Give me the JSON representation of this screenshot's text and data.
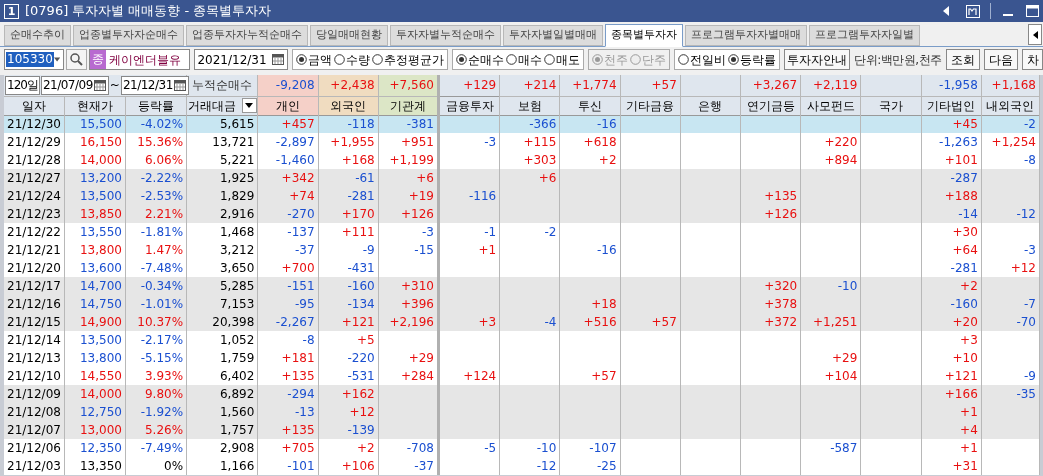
{
  "window": {
    "badge": "1",
    "title": "[0796] 투자자별 매매동향 - 종목별투자자"
  },
  "tabs": [
    {
      "label": "순매수추이",
      "selected": false
    },
    {
      "label": "업종별투자자순매수",
      "selected": false
    },
    {
      "label": "업종투자자누적순매수",
      "selected": false
    },
    {
      "label": "당일매매현황",
      "selected": false
    },
    {
      "label": "투자자별누적순매수",
      "selected": false
    },
    {
      "label": "투자자별일별매매",
      "selected": false
    },
    {
      "label": "종목별투자자",
      "selected": true
    },
    {
      "label": "프로그램투자자별매매",
      "selected": false
    },
    {
      "label": "프로그램투자자일별",
      "selected": false
    }
  ],
  "toolbar": {
    "code": "105330",
    "market_badge": "종",
    "stock_name": "케이엔더블유",
    "date": "2021/12/31",
    "radio_groups": [
      {
        "disabled": false,
        "options": [
          {
            "label": "금액",
            "selected": true
          },
          {
            "label": "수량",
            "selected": false
          },
          {
            "label": "추정평균가",
            "selected": false
          }
        ]
      },
      {
        "disabled": false,
        "options": [
          {
            "label": "순매수",
            "selected": true
          },
          {
            "label": "매수",
            "selected": false
          },
          {
            "label": "매도",
            "selected": false
          }
        ]
      },
      {
        "disabled": true,
        "options": [
          {
            "label": "천주",
            "selected": true
          },
          {
            "label": "단주",
            "selected": false
          }
        ]
      },
      {
        "disabled": false,
        "options": [
          {
            "label": "전일비",
            "selected": false
          },
          {
            "label": "등락률",
            "selected": true
          }
        ]
      }
    ],
    "guide_button": "투자자안내",
    "unit": "단위:백만원,천주",
    "buttons": [
      "조회",
      "다음",
      "차"
    ]
  },
  "summary": {
    "period": "120일",
    "from": "21/07/09",
    "tilde": "~",
    "to": "21/12/31",
    "label": "누적순매수",
    "values": [
      {
        "kind": "net",
        "text": "-9,208"
      },
      {
        "kind": "net",
        "text": "+2,438"
      },
      {
        "kind": "net",
        "text": "+7,560"
      },
      {
        "kind": "net",
        "text": "+129"
      },
      {
        "kind": "net",
        "text": "+214"
      },
      {
        "kind": "net",
        "text": "+1,774"
      },
      {
        "kind": "net",
        "text": "+57"
      },
      {
        "kind": "blank"
      },
      {
        "kind": "net",
        "text": "+3,267"
      },
      {
        "kind": "net",
        "text": "+2,119"
      },
      {
        "kind": "blank"
      },
      {
        "kind": "net",
        "text": "-1,958"
      },
      {
        "kind": "net",
        "text": "+1,168"
      }
    ]
  },
  "table": {
    "columns": [
      "일자",
      "현재가",
      "등락률",
      "거래대금",
      "개인",
      "외국인",
      "기관계",
      "금융투자",
      "보험",
      "투신",
      "기타금융",
      "은행",
      "연기금등",
      "사모펀드",
      "국가",
      "기타법인",
      "내외국인"
    ],
    "rows": [
      {
        "date": "21/12/30",
        "price": "15,500",
        "change": "-4.02%",
        "volume": "5,615",
        "color": "#1a4fd0",
        "shaded": false,
        "selected": true,
        "investors": [
          {
            "kind": "net",
            "text": "+457"
          },
          {
            "kind": "net",
            "text": "-118"
          },
          {
            "kind": "net",
            "text": "-381"
          },
          {
            "kind": "blank"
          },
          {
            "kind": "net",
            "text": "-366"
          },
          {
            "kind": "net",
            "text": "-16"
          },
          {
            "kind": "blank"
          },
          {
            "kind": "blank"
          },
          {
            "kind": "blank"
          },
          {
            "kind": "blank"
          },
          {
            "kind": "blank"
          },
          {
            "kind": "net",
            "text": "+45"
          },
          {
            "kind": "net",
            "text": "-2"
          }
        ]
      },
      {
        "date": "21/12/29",
        "price": "16,150",
        "change": "15.36%",
        "volume": "13,721",
        "color": "#e81010",
        "shaded": false,
        "selected": false,
        "investors": [
          {
            "kind": "net",
            "text": "-2,897"
          },
          {
            "kind": "net",
            "text": "+1,955"
          },
          {
            "kind": "net",
            "text": "+951"
          },
          {
            "kind": "net",
            "text": "-3"
          },
          {
            "kind": "net",
            "text": "+115"
          },
          {
            "kind": "net",
            "text": "+618"
          },
          {
            "kind": "blank"
          },
          {
            "kind": "blank"
          },
          {
            "kind": "blank"
          },
          {
            "kind": "net",
            "text": "+220"
          },
          {
            "kind": "blank"
          },
          {
            "kind": "net",
            "text": "-1,263"
          },
          {
            "kind": "net",
            "text": "+1,254"
          }
        ]
      },
      {
        "date": "21/12/28",
        "price": "14,000",
        "change": "6.06%",
        "volume": "5,221",
        "color": "#e81010",
        "shaded": false,
        "selected": false,
        "investors": [
          {
            "kind": "net",
            "text": "-1,460"
          },
          {
            "kind": "net",
            "text": "+168"
          },
          {
            "kind": "net",
            "text": "+1,199"
          },
          {
            "kind": "blank"
          },
          {
            "kind": "net",
            "text": "+303"
          },
          {
            "kind": "net",
            "text": "+2"
          },
          {
            "kind": "blank"
          },
          {
            "kind": "blank"
          },
          {
            "kind": "blank"
          },
          {
            "kind": "net",
            "text": "+894"
          },
          {
            "kind": "blank"
          },
          {
            "kind": "net",
            "text": "+101"
          },
          {
            "kind": "net",
            "text": "-8"
          }
        ]
      },
      {
        "date": "21/12/27",
        "price": "13,200",
        "change": "-2.22%",
        "volume": "1,925",
        "color": "#1a4fd0",
        "shaded": true,
        "selected": false,
        "investors": [
          {
            "kind": "net",
            "text": "+342"
          },
          {
            "kind": "net",
            "text": "-61"
          },
          {
            "kind": "net",
            "text": "+6"
          },
          {
            "kind": "blank"
          },
          {
            "kind": "net",
            "text": "+6"
          },
          {
            "kind": "blank"
          },
          {
            "kind": "blank"
          },
          {
            "kind": "blank"
          },
          {
            "kind": "blank"
          },
          {
            "kind": "blank"
          },
          {
            "kind": "blank"
          },
          {
            "kind": "net",
            "text": "-287"
          },
          {
            "kind": "blank"
          }
        ]
      },
      {
        "date": "21/12/24",
        "price": "13,500",
        "change": "-2.53%",
        "volume": "1,829",
        "color": "#1a4fd0",
        "shaded": true,
        "selected": false,
        "investors": [
          {
            "kind": "net",
            "text": "+74"
          },
          {
            "kind": "net",
            "text": "-281"
          },
          {
            "kind": "net",
            "text": "+19"
          },
          {
            "kind": "net",
            "text": "-116"
          },
          {
            "kind": "blank"
          },
          {
            "kind": "blank"
          },
          {
            "kind": "blank"
          },
          {
            "kind": "blank"
          },
          {
            "kind": "net",
            "text": "+135"
          },
          {
            "kind": "blank"
          },
          {
            "kind": "blank"
          },
          {
            "kind": "net",
            "text": "+188"
          },
          {
            "kind": "blank"
          }
        ]
      },
      {
        "date": "21/12/23",
        "price": "13,850",
        "change": "2.21%",
        "volume": "2,916",
        "color": "#e81010",
        "shaded": true,
        "selected": false,
        "investors": [
          {
            "kind": "net",
            "text": "-270"
          },
          {
            "kind": "net",
            "text": "+170"
          },
          {
            "kind": "net",
            "text": "+126"
          },
          {
            "kind": "blank"
          },
          {
            "kind": "blank"
          },
          {
            "kind": "blank"
          },
          {
            "kind": "blank"
          },
          {
            "kind": "blank"
          },
          {
            "kind": "net",
            "text": "+126"
          },
          {
            "kind": "blank"
          },
          {
            "kind": "blank"
          },
          {
            "kind": "net",
            "text": "-14"
          },
          {
            "kind": "net",
            "text": "-12"
          }
        ]
      },
      {
        "date": "21/12/22",
        "price": "13,550",
        "change": "-1.81%",
        "volume": "1,468",
        "color": "#1a4fd0",
        "shaded": false,
        "selected": false,
        "investors": [
          {
            "kind": "net",
            "text": "-137"
          },
          {
            "kind": "net",
            "text": "+111"
          },
          {
            "kind": "net",
            "text": "-3"
          },
          {
            "kind": "net",
            "text": "-1"
          },
          {
            "kind": "net",
            "text": "-2"
          },
          {
            "kind": "blank"
          },
          {
            "kind": "blank"
          },
          {
            "kind": "blank"
          },
          {
            "kind": "blank"
          },
          {
            "kind": "blank"
          },
          {
            "kind": "blank"
          },
          {
            "kind": "net",
            "text": "+30"
          },
          {
            "kind": "blank"
          }
        ]
      },
      {
        "date": "21/12/21",
        "price": "13,800",
        "change": "1.47%",
        "volume": "3,212",
        "color": "#e81010",
        "shaded": false,
        "selected": false,
        "investors": [
          {
            "kind": "net",
            "text": "-37"
          },
          {
            "kind": "net",
            "text": "-9"
          },
          {
            "kind": "net",
            "text": "-15"
          },
          {
            "kind": "net",
            "text": "+1"
          },
          {
            "kind": "blank"
          },
          {
            "kind": "net",
            "text": "-16"
          },
          {
            "kind": "blank"
          },
          {
            "kind": "blank"
          },
          {
            "kind": "blank"
          },
          {
            "kind": "blank"
          },
          {
            "kind": "blank"
          },
          {
            "kind": "net",
            "text": "+64"
          },
          {
            "kind": "net",
            "text": "-3"
          }
        ]
      },
      {
        "date": "21/12/20",
        "price": "13,600",
        "change": "-7.48%",
        "volume": "3,650",
        "color": "#1a4fd0",
        "shaded": false,
        "selected": false,
        "investors": [
          {
            "kind": "net",
            "text": "+700"
          },
          {
            "kind": "net",
            "text": "-431"
          },
          {
            "kind": "blank"
          },
          {
            "kind": "blank"
          },
          {
            "kind": "blank"
          },
          {
            "kind": "blank"
          },
          {
            "kind": "blank"
          },
          {
            "kind": "blank"
          },
          {
            "kind": "blank"
          },
          {
            "kind": "blank"
          },
          {
            "kind": "blank"
          },
          {
            "kind": "net",
            "text": "-281"
          },
          {
            "kind": "net",
            "text": "+12"
          }
        ]
      },
      {
        "date": "21/12/17",
        "price": "14,700",
        "change": "-0.34%",
        "volume": "5,285",
        "color": "#1a4fd0",
        "shaded": true,
        "selected": false,
        "investors": [
          {
            "kind": "net",
            "text": "-151"
          },
          {
            "kind": "net",
            "text": "-160"
          },
          {
            "kind": "net",
            "text": "+310"
          },
          {
            "kind": "blank"
          },
          {
            "kind": "blank"
          },
          {
            "kind": "blank"
          },
          {
            "kind": "blank"
          },
          {
            "kind": "blank"
          },
          {
            "kind": "net",
            "text": "+320"
          },
          {
            "kind": "net",
            "text": "-10"
          },
          {
            "kind": "blank"
          },
          {
            "kind": "net",
            "text": "+2"
          },
          {
            "kind": "blank"
          }
        ]
      },
      {
        "date": "21/12/16",
        "price": "14,750",
        "change": "-1.01%",
        "volume": "7,153",
        "color": "#1a4fd0",
        "shaded": true,
        "selected": false,
        "investors": [
          {
            "kind": "net",
            "text": "-95"
          },
          {
            "kind": "net",
            "text": "-134"
          },
          {
            "kind": "net",
            "text": "+396"
          },
          {
            "kind": "blank"
          },
          {
            "kind": "blank"
          },
          {
            "kind": "net",
            "text": "+18"
          },
          {
            "kind": "blank"
          },
          {
            "kind": "blank"
          },
          {
            "kind": "net",
            "text": "+378"
          },
          {
            "kind": "blank"
          },
          {
            "kind": "blank"
          },
          {
            "kind": "net",
            "text": "-160"
          },
          {
            "kind": "net",
            "text": "-7"
          }
        ]
      },
      {
        "date": "21/12/15",
        "price": "14,900",
        "change": "10.37%",
        "volume": "20,398",
        "color": "#e81010",
        "shaded": true,
        "selected": false,
        "investors": [
          {
            "kind": "net",
            "text": "-2,267"
          },
          {
            "kind": "net",
            "text": "+121"
          },
          {
            "kind": "net",
            "text": "+2,196"
          },
          {
            "kind": "net",
            "text": "+3"
          },
          {
            "kind": "net",
            "text": "-4"
          },
          {
            "kind": "net",
            "text": "+516"
          },
          {
            "kind": "net",
            "text": "+57"
          },
          {
            "kind": "blank"
          },
          {
            "kind": "net",
            "text": "+372"
          },
          {
            "kind": "net",
            "text": "+1,251"
          },
          {
            "kind": "blank"
          },
          {
            "kind": "net",
            "text": "+20"
          },
          {
            "kind": "net",
            "text": "-70"
          }
        ]
      },
      {
        "date": "21/12/14",
        "price": "13,500",
        "change": "-2.17%",
        "volume": "1,052",
        "color": "#1a4fd0",
        "shaded": false,
        "selected": false,
        "investors": [
          {
            "kind": "net",
            "text": "-8"
          },
          {
            "kind": "net",
            "text": "+5"
          },
          {
            "kind": "blank"
          },
          {
            "kind": "blank"
          },
          {
            "kind": "blank"
          },
          {
            "kind": "blank"
          },
          {
            "kind": "blank"
          },
          {
            "kind": "blank"
          },
          {
            "kind": "blank"
          },
          {
            "kind": "blank"
          },
          {
            "kind": "blank"
          },
          {
            "kind": "net",
            "text": "+3"
          },
          {
            "kind": "blank"
          }
        ]
      },
      {
        "date": "21/12/13",
        "price": "13,800",
        "change": "-5.15%",
        "volume": "1,759",
        "color": "#1a4fd0",
        "shaded": false,
        "selected": false,
        "investors": [
          {
            "kind": "net",
            "text": "+181"
          },
          {
            "kind": "net",
            "text": "-220"
          },
          {
            "kind": "net",
            "text": "+29"
          },
          {
            "kind": "blank"
          },
          {
            "kind": "blank"
          },
          {
            "kind": "blank"
          },
          {
            "kind": "blank"
          },
          {
            "kind": "blank"
          },
          {
            "kind": "blank"
          },
          {
            "kind": "net",
            "text": "+29"
          },
          {
            "kind": "blank"
          },
          {
            "kind": "net",
            "text": "+10"
          },
          {
            "kind": "blank"
          }
        ]
      },
      {
        "date": "21/12/10",
        "price": "14,550",
        "change": "3.93%",
        "volume": "6,402",
        "color": "#e81010",
        "shaded": false,
        "selected": false,
        "investors": [
          {
            "kind": "net",
            "text": "+135"
          },
          {
            "kind": "net",
            "text": "-531"
          },
          {
            "kind": "net",
            "text": "+284"
          },
          {
            "kind": "net",
            "text": "+124"
          },
          {
            "kind": "blank"
          },
          {
            "kind": "net",
            "text": "+57"
          },
          {
            "kind": "blank"
          },
          {
            "kind": "blank"
          },
          {
            "kind": "blank"
          },
          {
            "kind": "net",
            "text": "+104"
          },
          {
            "kind": "blank"
          },
          {
            "kind": "net",
            "text": "+121"
          },
          {
            "kind": "net",
            "text": "-9"
          }
        ]
      },
      {
        "date": "21/12/09",
        "price": "14,000",
        "change": "9.80%",
        "volume": "6,892",
        "color": "#e81010",
        "shaded": true,
        "selected": false,
        "investors": [
          {
            "kind": "net",
            "text": "-294"
          },
          {
            "kind": "net",
            "text": "+162"
          },
          {
            "kind": "blank"
          },
          {
            "kind": "blank"
          },
          {
            "kind": "blank"
          },
          {
            "kind": "blank"
          },
          {
            "kind": "blank"
          },
          {
            "kind": "blank"
          },
          {
            "kind": "blank"
          },
          {
            "kind": "blank"
          },
          {
            "kind": "blank"
          },
          {
            "kind": "net",
            "text": "+166"
          },
          {
            "kind": "net",
            "text": "-35"
          }
        ]
      },
      {
        "date": "21/12/08",
        "price": "12,750",
        "change": "-1.92%",
        "volume": "1,560",
        "color": "#1a4fd0",
        "shaded": true,
        "selected": false,
        "investors": [
          {
            "kind": "net",
            "text": "-13"
          },
          {
            "kind": "net",
            "text": "+12"
          },
          {
            "kind": "blank"
          },
          {
            "kind": "blank"
          },
          {
            "kind": "blank"
          },
          {
            "kind": "blank"
          },
          {
            "kind": "blank"
          },
          {
            "kind": "blank"
          },
          {
            "kind": "blank"
          },
          {
            "kind": "blank"
          },
          {
            "kind": "blank"
          },
          {
            "kind": "net",
            "text": "+1"
          },
          {
            "kind": "blank"
          }
        ]
      },
      {
        "date": "21/12/07",
        "price": "13,000",
        "change": "5.26%",
        "volume": "1,757",
        "color": "#e81010",
        "shaded": true,
        "selected": false,
        "investors": [
          {
            "kind": "net",
            "text": "+135"
          },
          {
            "kind": "net",
            "text": "-139"
          },
          {
            "kind": "blank"
          },
          {
            "kind": "blank"
          },
          {
            "kind": "blank"
          },
          {
            "kind": "blank"
          },
          {
            "kind": "blank"
          },
          {
            "kind": "blank"
          },
          {
            "kind": "blank"
          },
          {
            "kind": "blank"
          },
          {
            "kind": "blank"
          },
          {
            "kind": "net",
            "text": "+4"
          },
          {
            "kind": "blank"
          }
        ]
      },
      {
        "date": "21/12/06",
        "price": "12,350",
        "change": "-7.49%",
        "volume": "2,908",
        "color": "#1a4fd0",
        "shaded": false,
        "selected": false,
        "investors": [
          {
            "kind": "net",
            "text": "+705"
          },
          {
            "kind": "net",
            "text": "+2"
          },
          {
            "kind": "net",
            "text": "-708"
          },
          {
            "kind": "net",
            "text": "-5"
          },
          {
            "kind": "net",
            "text": "-10"
          },
          {
            "kind": "net",
            "text": "-107"
          },
          {
            "kind": "blank"
          },
          {
            "kind": "blank"
          },
          {
            "kind": "blank"
          },
          {
            "kind": "net",
            "text": "-587"
          },
          {
            "kind": "blank"
          },
          {
            "kind": "net",
            "text": "+1"
          },
          {
            "kind": "blank"
          }
        ]
      },
      {
        "date": "21/12/03",
        "price": "13,350",
        "change": "0%",
        "volume": "1,166",
        "color": "#000000",
        "shaded": false,
        "selected": false,
        "investors": [
          {
            "kind": "net",
            "text": "-101"
          },
          {
            "kind": "net",
            "text": "+106"
          },
          {
            "kind": "net",
            "text": "-37"
          },
          {
            "kind": "blank"
          },
          {
            "kind": "net",
            "text": "-12"
          },
          {
            "kind": "net",
            "text": "-25"
          },
          {
            "kind": "blank"
          },
          {
            "kind": "blank"
          },
          {
            "kind": "blank"
          },
          {
            "kind": "blank"
          },
          {
            "kind": "blank"
          },
          {
            "kind": "net",
            "text": "+31"
          },
          {
            "kind": "blank"
          }
        ]
      }
    ]
  }
}
